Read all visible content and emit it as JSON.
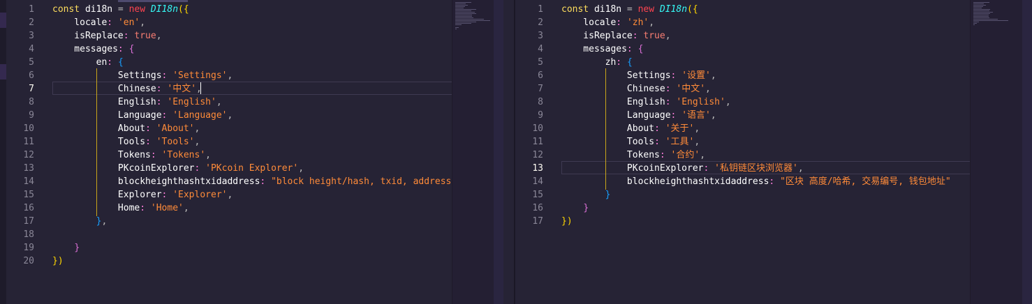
{
  "left_editor": {
    "line_numbers": [
      "1",
      "2",
      "3",
      "4",
      "5",
      "6",
      "7",
      "8",
      "9",
      "10",
      "11",
      "12",
      "13",
      "14",
      "15",
      "16",
      "17",
      "18",
      "19",
      "20"
    ],
    "active_line": "7",
    "lines": [
      [
        {
          "t": "const ",
          "c": "kw"
        },
        {
          "t": "di18n",
          "c": "key"
        },
        {
          "t": " = ",
          "c": "punc"
        },
        {
          "t": "new ",
          "c": "ctor"
        },
        {
          "t": "DI18n",
          "c": "fn"
        },
        {
          "t": "({",
          "c": "brace1"
        }
      ],
      [
        {
          "t": "    locale",
          "c": "key"
        },
        {
          "t": ": ",
          "c": "prop"
        },
        {
          "t": "'en'",
          "c": "str"
        },
        {
          "t": ",",
          "c": "punc"
        }
      ],
      [
        {
          "t": "    isReplace",
          "c": "key"
        },
        {
          "t": ": ",
          "c": "prop"
        },
        {
          "t": "true",
          "c": "bool"
        },
        {
          "t": ",",
          "c": "punc"
        }
      ],
      [
        {
          "t": "    messages",
          "c": "key"
        },
        {
          "t": ": ",
          "c": "prop"
        },
        {
          "t": "{",
          "c": "brace2"
        }
      ],
      [
        {
          "t": "        en",
          "c": "key"
        },
        {
          "t": ": ",
          "c": "prop"
        },
        {
          "t": "{",
          "c": "brace3"
        }
      ],
      [
        {
          "t": "            Settings",
          "c": "key"
        },
        {
          "t": ": ",
          "c": "prop"
        },
        {
          "t": "'Settings'",
          "c": "str"
        },
        {
          "t": ",",
          "c": "punc"
        }
      ],
      [
        {
          "t": "            Chinese",
          "c": "key"
        },
        {
          "t": ": ",
          "c": "prop"
        },
        {
          "t": "'中文'",
          "c": "str"
        },
        {
          "t": ",",
          "c": "punc"
        }
      ],
      [
        {
          "t": "            English",
          "c": "key"
        },
        {
          "t": ": ",
          "c": "prop"
        },
        {
          "t": "'English'",
          "c": "str"
        },
        {
          "t": ",",
          "c": "punc"
        }
      ],
      [
        {
          "t": "            Language",
          "c": "key"
        },
        {
          "t": ": ",
          "c": "prop"
        },
        {
          "t": "'Language'",
          "c": "str"
        },
        {
          "t": ",",
          "c": "punc"
        }
      ],
      [
        {
          "t": "            About",
          "c": "key"
        },
        {
          "t": ": ",
          "c": "prop"
        },
        {
          "t": "'About'",
          "c": "str"
        },
        {
          "t": ",",
          "c": "punc"
        }
      ],
      [
        {
          "t": "            Tools",
          "c": "key"
        },
        {
          "t": ": ",
          "c": "prop"
        },
        {
          "t": "'Tools'",
          "c": "str"
        },
        {
          "t": ",",
          "c": "punc"
        }
      ],
      [
        {
          "t": "            Tokens",
          "c": "key"
        },
        {
          "t": ": ",
          "c": "prop"
        },
        {
          "t": "'Tokens'",
          "c": "str"
        },
        {
          "t": ",",
          "c": "punc"
        }
      ],
      [
        {
          "t": "            PKcoinExplorer",
          "c": "key"
        },
        {
          "t": ": ",
          "c": "prop"
        },
        {
          "t": "'PKcoin Explorer'",
          "c": "str"
        },
        {
          "t": ",",
          "c": "punc"
        }
      ],
      [
        {
          "t": "            blockheighthashtxidaddress",
          "c": "key"
        },
        {
          "t": ": ",
          "c": "prop"
        },
        {
          "t": "\"block height/hash, txid, address\"",
          "c": "str"
        },
        {
          "t": ",",
          "c": "punc"
        }
      ],
      [
        {
          "t": "            Explorer",
          "c": "key"
        },
        {
          "t": ": ",
          "c": "prop"
        },
        {
          "t": "'Explorer'",
          "c": "str"
        },
        {
          "t": ",",
          "c": "punc"
        }
      ],
      [
        {
          "t": "            Home",
          "c": "key"
        },
        {
          "t": ": ",
          "c": "prop"
        },
        {
          "t": "'Home'",
          "c": "str"
        },
        {
          "t": ",",
          "c": "punc"
        }
      ],
      [
        {
          "t": "        ",
          "c": "punc"
        },
        {
          "t": "}",
          "c": "brace3"
        },
        {
          "t": ",",
          "c": "punc"
        }
      ],
      [],
      [
        {
          "t": "    ",
          "c": "punc"
        },
        {
          "t": "}",
          "c": "brace2"
        }
      ],
      [
        {
          "t": "})",
          "c": "brace1"
        }
      ]
    ]
  },
  "right_editor": {
    "line_numbers": [
      "1",
      "2",
      "3",
      "4",
      "5",
      "6",
      "7",
      "8",
      "9",
      "10",
      "11",
      "12",
      "13",
      "14",
      "15",
      "16",
      "17"
    ],
    "active_line": "13",
    "lines": [
      [
        {
          "t": "const ",
          "c": "kw"
        },
        {
          "t": "di18n",
          "c": "key"
        },
        {
          "t": " = ",
          "c": "punc"
        },
        {
          "t": "new ",
          "c": "ctor"
        },
        {
          "t": "DI18n",
          "c": "fn"
        },
        {
          "t": "({",
          "c": "brace1"
        }
      ],
      [
        {
          "t": "    locale",
          "c": "key"
        },
        {
          "t": ": ",
          "c": "prop"
        },
        {
          "t": "'zh'",
          "c": "str"
        },
        {
          "t": ",",
          "c": "punc"
        }
      ],
      [
        {
          "t": "    isReplace",
          "c": "key"
        },
        {
          "t": ": ",
          "c": "prop"
        },
        {
          "t": "true",
          "c": "bool"
        },
        {
          "t": ",",
          "c": "punc"
        }
      ],
      [
        {
          "t": "    messages",
          "c": "key"
        },
        {
          "t": ": ",
          "c": "prop"
        },
        {
          "t": "{",
          "c": "brace2"
        }
      ],
      [
        {
          "t": "        zh",
          "c": "key"
        },
        {
          "t": ": ",
          "c": "prop"
        },
        {
          "t": "{",
          "c": "brace3"
        }
      ],
      [
        {
          "t": "            Settings",
          "c": "key"
        },
        {
          "t": ": ",
          "c": "prop"
        },
        {
          "t": "'设置'",
          "c": "str"
        },
        {
          "t": ",",
          "c": "punc"
        }
      ],
      [
        {
          "t": "            Chinese",
          "c": "key"
        },
        {
          "t": ": ",
          "c": "prop"
        },
        {
          "t": "'中文'",
          "c": "str"
        },
        {
          "t": ",",
          "c": "punc"
        }
      ],
      [
        {
          "t": "            English",
          "c": "key"
        },
        {
          "t": ": ",
          "c": "prop"
        },
        {
          "t": "'English'",
          "c": "str"
        },
        {
          "t": ",",
          "c": "punc"
        }
      ],
      [
        {
          "t": "            Language",
          "c": "key"
        },
        {
          "t": ": ",
          "c": "prop"
        },
        {
          "t": "'语言'",
          "c": "str"
        },
        {
          "t": ",",
          "c": "punc"
        }
      ],
      [
        {
          "t": "            About",
          "c": "key"
        },
        {
          "t": ": ",
          "c": "prop"
        },
        {
          "t": "'关于'",
          "c": "str"
        },
        {
          "t": ",",
          "c": "punc"
        }
      ],
      [
        {
          "t": "            Tools",
          "c": "key"
        },
        {
          "t": ": ",
          "c": "prop"
        },
        {
          "t": "'工具'",
          "c": "str"
        },
        {
          "t": ",",
          "c": "punc"
        }
      ],
      [
        {
          "t": "            Tokens",
          "c": "key"
        },
        {
          "t": ": ",
          "c": "prop"
        },
        {
          "t": "'合约'",
          "c": "str"
        },
        {
          "t": ",",
          "c": "punc"
        }
      ],
      [
        {
          "t": "            PKcoinExplorer",
          "c": "key"
        },
        {
          "t": ": ",
          "c": "prop"
        },
        {
          "t": "'私钥链区块浏览器'",
          "c": "str"
        },
        {
          "t": ",",
          "c": "punc"
        }
      ],
      [
        {
          "t": "            blockheighthashtxidaddress",
          "c": "key"
        },
        {
          "t": ": ",
          "c": "prop"
        },
        {
          "t": "\"区块 高度/哈希, 交易编号, 钱包地址\"",
          "c": "str"
        }
      ],
      [
        {
          "t": "        ",
          "c": "punc"
        },
        {
          "t": "}",
          "c": "brace3"
        }
      ],
      [
        {
          "t": "    ",
          "c": "punc"
        },
        {
          "t": "}",
          "c": "brace2"
        }
      ],
      [
        {
          "t": "})",
          "c": "brace1"
        }
      ]
    ]
  },
  "colors": {
    "background": "#262335",
    "keyword": "#fede5d",
    "string": "#ff8b39",
    "function": "#36f9f6",
    "property": "#ff7edb",
    "indent_guide": "#c9a61a"
  }
}
